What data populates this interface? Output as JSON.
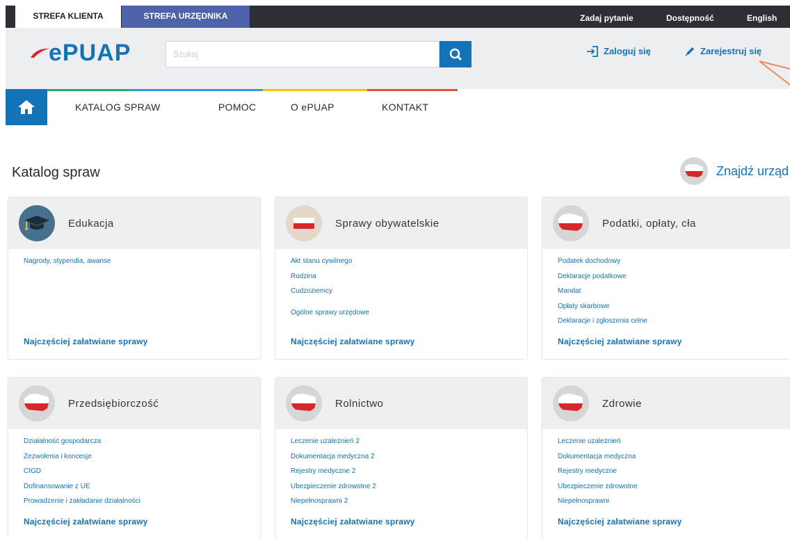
{
  "top_bar": {
    "zones": [
      {
        "label": "STREFA KLIENTA"
      },
      {
        "label": "STREFA URZĘDNIKA"
      }
    ],
    "links": [
      {
        "label": "Zadaj pytanie"
      },
      {
        "label": "Dostępność"
      },
      {
        "label": "English"
      }
    ]
  },
  "header": {
    "logo_text": "ePUAP",
    "search": {
      "placeholder": "Szukaj",
      "value": ""
    },
    "login_label": "Zaloguj się",
    "register_label": "Zarejestruj się"
  },
  "nav": {
    "items": [
      {
        "label": "KATALOG SPRAW"
      },
      {
        "label": "POMOC"
      },
      {
        "label": "O ePUAP"
      },
      {
        "label": "KONTAKT"
      }
    ],
    "colors": [
      "#27ae60",
      "#3498db",
      "#f1c40f",
      "#e74c3c"
    ]
  },
  "catalog": {
    "title": "Katalog spraw",
    "find_office": "Znajdź urząd",
    "footer_label": "Najczęściej załatwiane sprawy",
    "cards": [
      {
        "title": "Edukacja",
        "icon": "graduation-cap-icon",
        "links": [
          "Nagrody, stypendia, awanse"
        ]
      },
      {
        "title": "Sprawy obywatelskie",
        "icon": "flag-icon",
        "links": [
          "Akt stanu cywilnego",
          "Rodzina",
          "Cudzoziemcy",
          "Ogólne sprawy urzędowe"
        ]
      },
      {
        "title": "Podatki, opłaty, cła",
        "icon": "poland-map-icon",
        "links": [
          "Podatek dochodowy",
          "Deklaracje podatkowe",
          "Mandat",
          "Opłaty skarbowe",
          "Deklaracje i zgłoszenia celne"
        ]
      },
      {
        "title": "Przedsiębiorczość",
        "icon": "poland-map-icon",
        "links": [
          "Działalność gospodarcza",
          "Zezwolenia i koncesje",
          "CIGD",
          "Dofinansowanie z UE",
          "Prowadzenie i zakładanie działalności"
        ]
      },
      {
        "title": "Rolnictwo",
        "icon": "poland-map-icon",
        "links": [
          "Leczenie uzależnień 2",
          "Dokumentacja medyczna 2",
          "Rejestry medyczne 2",
          "Ubezpieczenie zdrowotne 2",
          "Niepełnosprawni 2"
        ]
      },
      {
        "title": "Zdrowie",
        "icon": "poland-map-icon",
        "links": [
          "Leczenie uzależnień",
          "Dokumentacja medyczna",
          "Rejestry medyczne",
          "Ubezpieczenie zdrowotne",
          "Niepełnosprawni"
        ]
      }
    ]
  },
  "colors": {
    "brand_blue": "#1473b6",
    "brand_red": "#d9262b",
    "top_bar_dark": "#2c2f33",
    "official_zone": "#4e62a8",
    "header_bg": "#eceef1"
  }
}
